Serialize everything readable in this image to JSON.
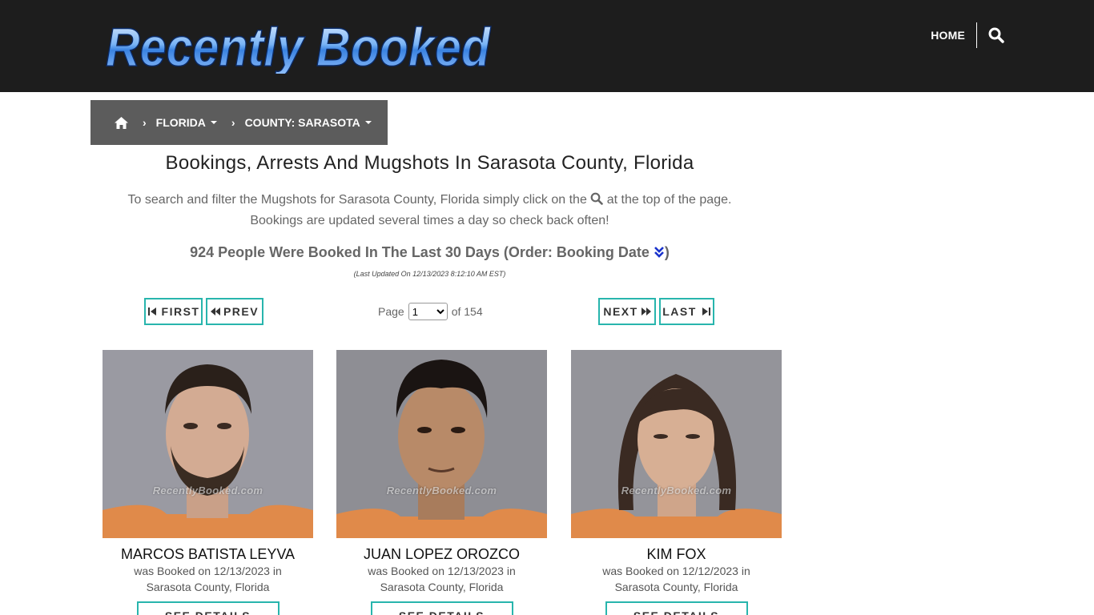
{
  "site": {
    "logo_text": "Recently Booked"
  },
  "nav": {
    "home_label": "HOME"
  },
  "breadcrumb": {
    "items": [
      {
        "label": "FLORIDA"
      },
      {
        "label": "COUNTY: SARASOTA"
      }
    ]
  },
  "main": {
    "title": "Bookings, Arrests And Mugshots In Sarasota County, Florida",
    "intro_before_icon": "To search and filter the Mugshots for Sarasota County, Florida simply click on the",
    "intro_after_icon": "at the top of the page.",
    "intro_line2": "Bookings are updated several times a day so check back often!",
    "count_text": "924 People Were Booked In The Last 30 Days (Order: Booking Date",
    "count_close": ")",
    "updated": "(Last Updated On 12/13/2023 8:12:10 AM EST)"
  },
  "pager": {
    "first_label": "FIRST",
    "prev_label": "PREV",
    "next_label": "NEXT",
    "last_label": "LAST",
    "page_label": "Page",
    "page_value": "1",
    "of_label": "of 154"
  },
  "cards": [
    {
      "name": "MARCOS BATISTA LEYVA",
      "booked_line": "was Booked on 12/13/2023 in",
      "county": "Sarasota County, Florida",
      "watermark": "RecentlyBooked.com",
      "details_label": "SEE DETAILS"
    },
    {
      "name": "JUAN LOPEZ OROZCO",
      "booked_line": "was Booked on 12/13/2023 in",
      "county": "Sarasota County, Florida",
      "watermark": "RecentlyBooked.com",
      "details_label": "SEE DETAILS"
    },
    {
      "name": "KIM FOX",
      "booked_line": "was Booked on 12/12/2023 in",
      "county": "Sarasota County, Florida",
      "watermark": "RecentlyBooked.com",
      "details_label": "SEE DETAILS"
    }
  ],
  "colors": {
    "header_bg": "#1d1d1d",
    "breadcrumb_bg": "#5c5c5c",
    "accent": "#28b5ad",
    "logo_blue": "#5aa0f0"
  }
}
